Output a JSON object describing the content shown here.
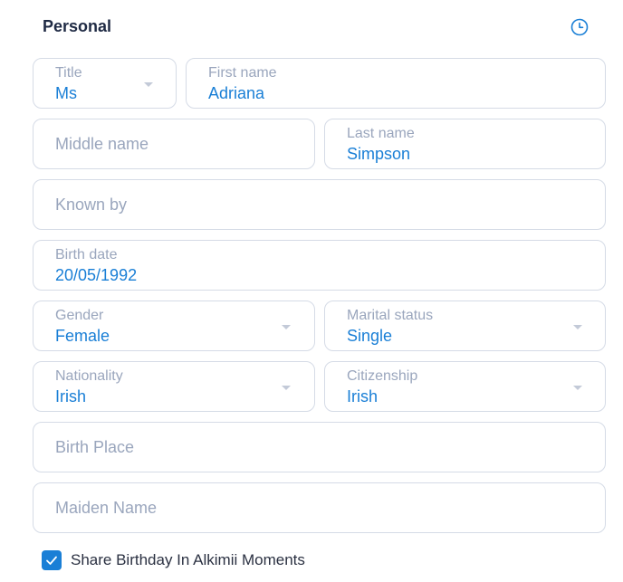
{
  "section": {
    "title": "Personal",
    "history_icon": "clock-icon"
  },
  "fields": {
    "title": {
      "label": "Title",
      "value": "Ms"
    },
    "first_name": {
      "label": "First name",
      "value": "Adriana"
    },
    "middle_name": {
      "placeholder": "Middle name"
    },
    "last_name": {
      "label": "Last name",
      "value": "Simpson"
    },
    "known_by": {
      "placeholder": "Known by"
    },
    "birth_date": {
      "label": "Birth date",
      "value": "20/05/1992"
    },
    "gender": {
      "label": "Gender",
      "value": "Female"
    },
    "marital_status": {
      "label": "Marital status",
      "value": "Single"
    },
    "nationality": {
      "label": "Nationality",
      "value": "Irish"
    },
    "citizenship": {
      "label": "Citizenship",
      "value": "Irish"
    },
    "birth_place": {
      "placeholder": "Birth Place"
    },
    "maiden_name": {
      "placeholder": "Maiden Name"
    }
  },
  "share_birthday": {
    "label": "Share Birthday In Alkimii Moments",
    "checked": true
  },
  "colors": {
    "accent": "#1a7fd6",
    "border": "#d5dbe6",
    "label": "#9aa6bd",
    "heading": "#1f2a44"
  }
}
